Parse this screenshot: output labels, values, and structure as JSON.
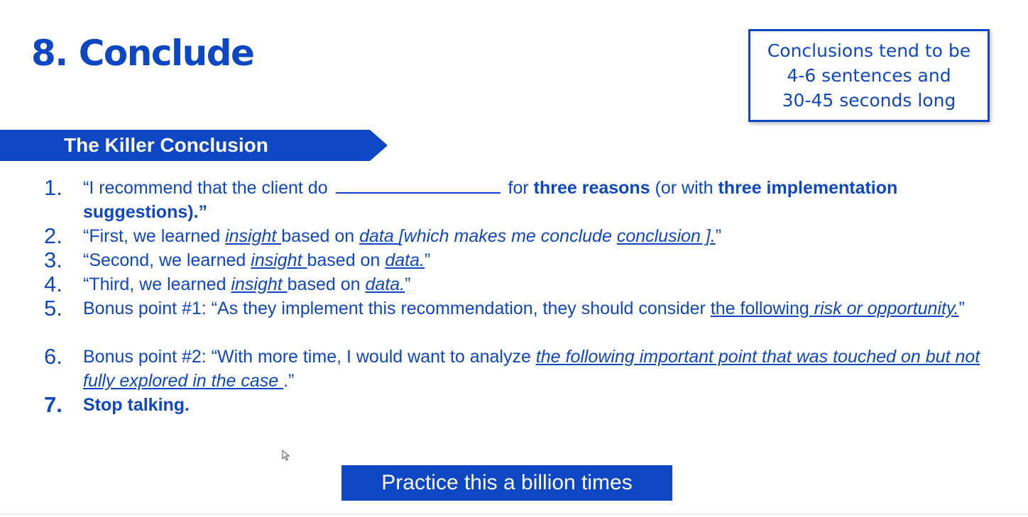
{
  "slide": {
    "title": "8. Conclude",
    "note": {
      "line1": "Conclusions tend to be",
      "line2": "4-6 sentences and",
      "line3": "30-45 seconds long"
    },
    "banner": "The Killer Conclusion",
    "steps": [
      {
        "num": "1.",
        "a": "“I recommend that the client do ",
        "b": " for ",
        "c": "three reasons",
        "d": " (or with ",
        "e": "three implementation suggestions",
        "f": ").”"
      },
      {
        "num": "2.",
        "a": "“First, we learned ",
        "b": " insight ",
        "c": " based on ",
        "d": " data ",
        "e": "[which makes me conclude ",
        "f": " conclusion ].",
        "g": "”"
      },
      {
        "num": "3.",
        "a": "“Second, we learned ",
        "b": " insight ",
        "c": " based on ",
        "d": " data.",
        "e": "”"
      },
      {
        "num": "4.",
        "a": "“Third, we learned ",
        "b": " insight ",
        "c": " based on ",
        "d": " data.",
        "e": "”"
      },
      {
        "num": "5.",
        "a": "Bonus point #1: “As they implement this recommendation, they should consider ",
        "b": " the following ",
        "c": "risk or opportunity.",
        "d": "”"
      },
      {
        "num": "6.",
        "a": "Bonus point #2: “With more time, I would want to analyze ",
        "b": " the following important point that was touched on but not fully explored in the case ",
        "c": ".”"
      },
      {
        "num": "7.",
        "a": "Stop talking."
      }
    ],
    "practice": "Practice this a billion times",
    "colors": {
      "accent": "#0d47c4",
      "background": "#ffffff"
    },
    "icons": {
      "cursor": "mouse-pointer-icon"
    }
  }
}
